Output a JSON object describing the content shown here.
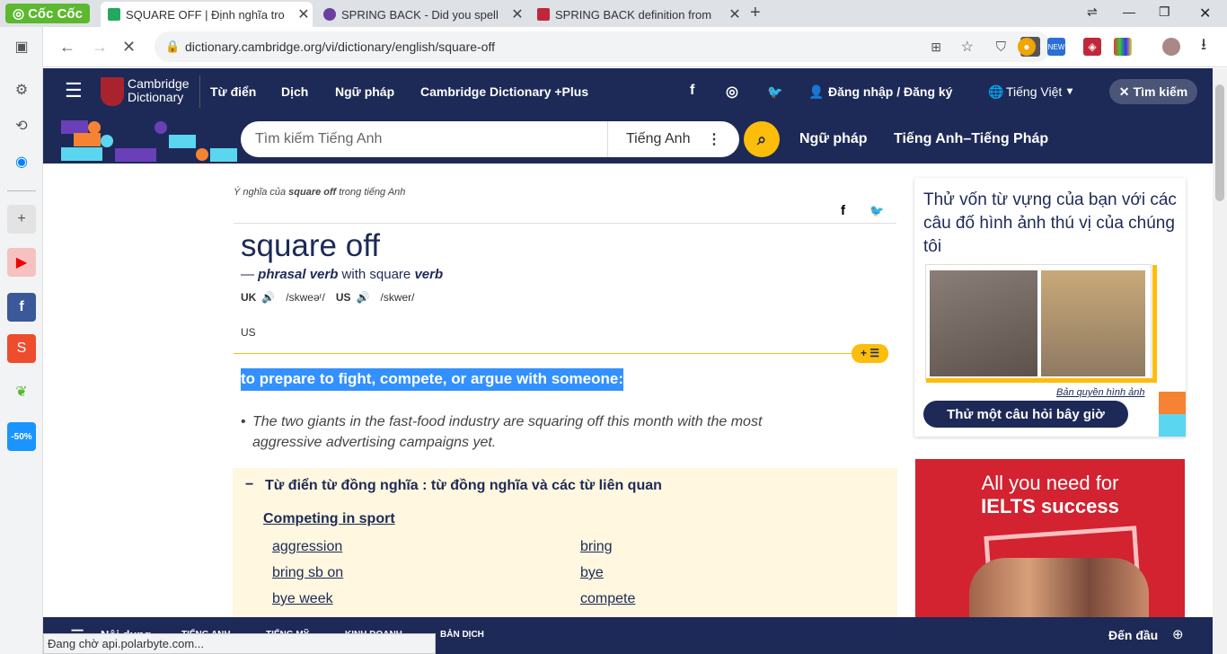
{
  "browser": {
    "logo": "Cốc Cốc",
    "tabs": [
      {
        "title": "SQUARE OFF | Định nghĩa tro",
        "icon_color": "#22a861",
        "active": true
      },
      {
        "title": "SPRING BACK - Did you spell",
        "icon_color": "#6b3fa0",
        "active": false
      },
      {
        "title": "SPRING BACK definition from",
        "icon_color": "#c0283a",
        "active": false
      }
    ],
    "url": "dictionary.cambridge.org/vi/dictionary/english/square-off",
    "status_text": "Đang chờ api.polarbyte.com..."
  },
  "site": {
    "logo_line1": "Cambridge",
    "logo_line2": "Dictionary",
    "nav": [
      "Từ điển",
      "Dịch",
      "Ngữ pháp",
      "Cambridge Dictionary +Plus"
    ],
    "login": "Đăng nhập / Đăng ký",
    "language": "Tiếng Việt",
    "search_btn": "Tìm kiếm",
    "search_placeholder": "Tìm kiếm Tiếng Anh",
    "search_lang": "Tiếng Anh",
    "sub_links": [
      "Ngữ pháp",
      "Tiếng Anh–Tiếng Pháp"
    ]
  },
  "entry": {
    "meaning_prefix": "Ý nghĩa của ",
    "meaning_word": "square off",
    "meaning_suffix": " trong tiếng Anh",
    "headword": "square off",
    "pos_dash": "— ",
    "pos": "phrasal verb",
    "with_text": " with square ",
    "with_pos": "verb",
    "uk_label": "UK",
    "uk_ipa": "/skweəʳ/",
    "us_label": "US",
    "us_ipa": "/skwer/",
    "us_region": "US",
    "definition": "to prepare to fight, compete, or argue with someone:",
    "example": "The two giants in the fast-food industry are squaring off this month with the most aggressive advertising campaigns yet.",
    "thesaurus_title": "Từ điển từ đồng nghĩa : từ đồng nghĩa và các từ liên quan",
    "thesaurus_category": "Competing in sport",
    "thesaurus_left": [
      "aggression",
      "bring sb on",
      "bye week"
    ],
    "thesaurus_right": [
      "bring",
      "bye",
      "compete"
    ]
  },
  "sidebar_ad": {
    "quiz_text": "Thử vốn từ vựng của bạn với các câu đố hình ảnh thú vị của chúng tôi",
    "copyright": "Bản quyền hình ảnh",
    "quiz_btn": "Thử một câu hỏi bây giờ",
    "ielts_line1": "All you need for",
    "ielts_line2": "IELTS success"
  },
  "bottom": {
    "items": [
      "Nội dung",
      "TIẾNG ANH",
      "TIẾNG MỸ",
      "KINH DOANH",
      "BẢN DỊCH"
    ],
    "top_link": "Đến đầu"
  },
  "colors": {
    "navy": "#1d2a57",
    "yellow": "#fcbd0b",
    "highlight": "#3390ff",
    "thesaurus_bg": "#fff7e0",
    "ad_red": "#d32230"
  }
}
